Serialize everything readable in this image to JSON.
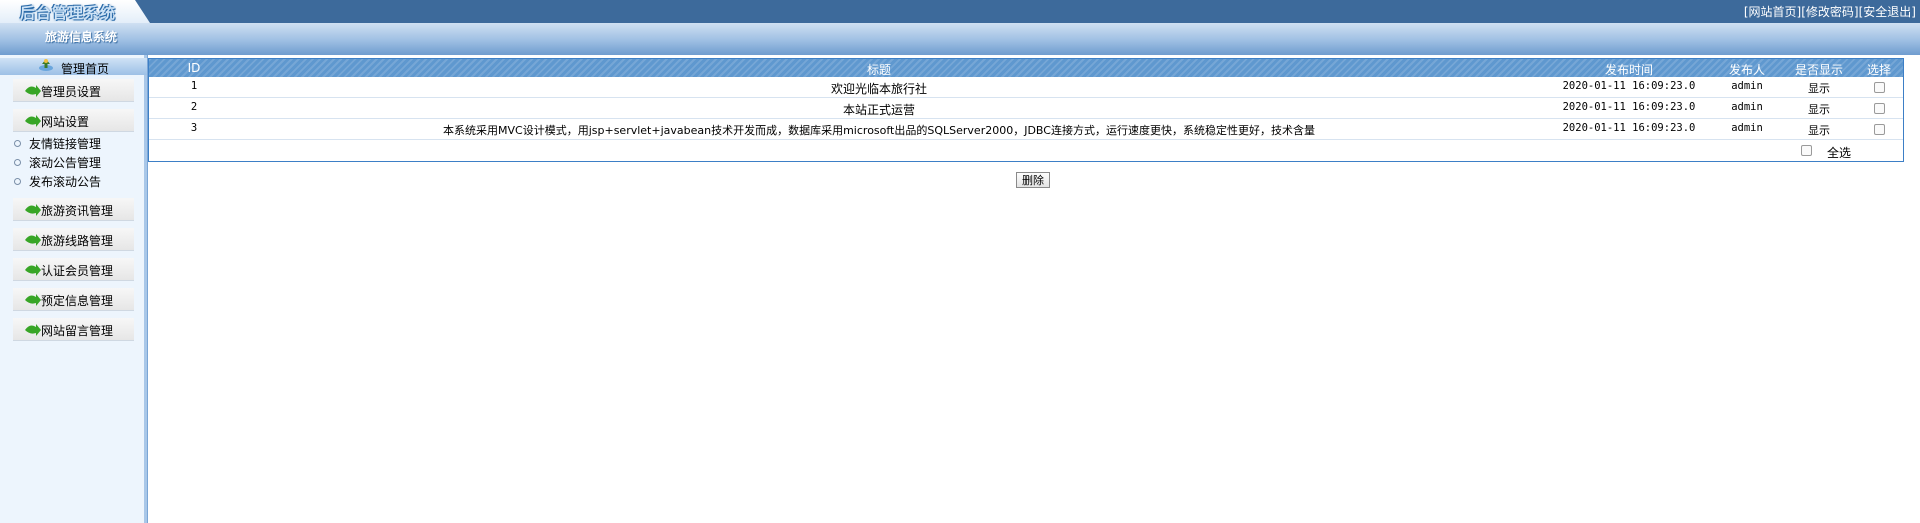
{
  "header": {
    "logo": "后台管理系统",
    "subtitle": "旅游信息系统",
    "links": [
      "[网站首页]",
      "[修改密码]",
      "[安全退出]"
    ]
  },
  "sidebar": {
    "home_label": "管理首页",
    "items": [
      {
        "label": "管理员设置"
      },
      {
        "label": "网站设置"
      },
      {
        "label": "旅游资讯管理"
      },
      {
        "label": "旅游线路管理"
      },
      {
        "label": "认证会员管理"
      },
      {
        "label": "预定信息管理"
      },
      {
        "label": "网站留言管理"
      }
    ],
    "sub_items": [
      "友情链接管理",
      "滚动公告管理",
      "发布滚动公告"
    ]
  },
  "table": {
    "columns": [
      "ID",
      "标题",
      "发布时间",
      "发布人",
      "是否显示",
      "选择"
    ],
    "rows": [
      {
        "id": "1",
        "title": "欢迎光临本旅行社",
        "time": "2020-01-11 16:09:23.0",
        "author": "admin",
        "show": "显示"
      },
      {
        "id": "2",
        "title": "本站正式运营",
        "time": "2020-01-11 16:09:23.0",
        "author": "admin",
        "show": "显示"
      },
      {
        "id": "3",
        "title": "本系统采用MVC设计模式，用jsp+servlet+javabean技术开发而成，数据库采用microsoft出品的SQLServer2000，JDBC连接方式，运行速度更快，系统稳定性更好，技术含量",
        "time": "2020-01-11 16:09:23.0",
        "author": "admin",
        "show": "显示"
      }
    ],
    "select_all": "全选"
  },
  "delete_button": "删除",
  "colors": {
    "top_bar": "#3d6a9b",
    "table_header": "#5f98cf",
    "table_border": "#3d7fc6",
    "sidebar_bg": "#edf5fd"
  }
}
